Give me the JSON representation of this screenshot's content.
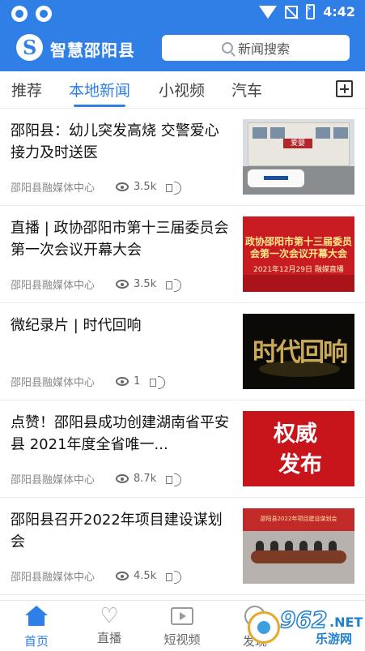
{
  "status_bar": {
    "time": "4:42"
  },
  "header": {
    "app_title": "智慧邵阳县",
    "search_placeholder": "新闻搜索"
  },
  "tabs": [
    {
      "label": "推荐",
      "active": false
    },
    {
      "label": "本地新闻",
      "active": true
    },
    {
      "label": "小视频",
      "active": false
    },
    {
      "label": "汽车",
      "active": false
    }
  ],
  "news": [
    {
      "title": "邵阳县：幼儿突发高烧 交警爱心接力及时送医",
      "source": "邵阳县融媒体中心",
      "views": "3.5k",
      "thumb_text": "爱婴"
    },
    {
      "title": "直播 | 政协邵阳市第十三届委员会第一次会议开幕大会",
      "source": "邵阳县融媒体中心",
      "views": "3.5k",
      "thumb_text": "政协邵阳市第十三届委员会第一次会议开幕大会",
      "thumb_subtext": "2021年12月29日 融媒直播"
    },
    {
      "title": "微纪录片 | 时代回响",
      "source": "邵阳县融媒体中心",
      "views": "1",
      "thumb_text": "时代回响"
    },
    {
      "title": "点赞！邵阳县成功创建湖南省平安县 2021年度全省唯一...",
      "source": "邵阳县融媒体中心",
      "views": "8.7k",
      "thumb_text_line1": "权威",
      "thumb_text_line2": "发布"
    },
    {
      "title": "邵阳县召开2022年项目建设谋划会",
      "source": "邵阳县融媒体中心",
      "views": "4.5k",
      "thumb_text": "邵阳县2022年项目建设谋划会"
    }
  ],
  "bottom_nav": [
    {
      "label": "首页",
      "icon": "home-icon",
      "active": true
    },
    {
      "label": "直播",
      "icon": "heart-icon",
      "active": false
    },
    {
      "label": "短视频",
      "icon": "video-icon",
      "active": false
    },
    {
      "label": "发现",
      "icon": "discover-icon",
      "active": false
    }
  ],
  "watermark": {
    "number": "962",
    "suffix": ".NET",
    "name": "乐游网"
  },
  "colors": {
    "brand": "#2f7fe6",
    "text": "#111111",
    "meta": "#888888"
  }
}
